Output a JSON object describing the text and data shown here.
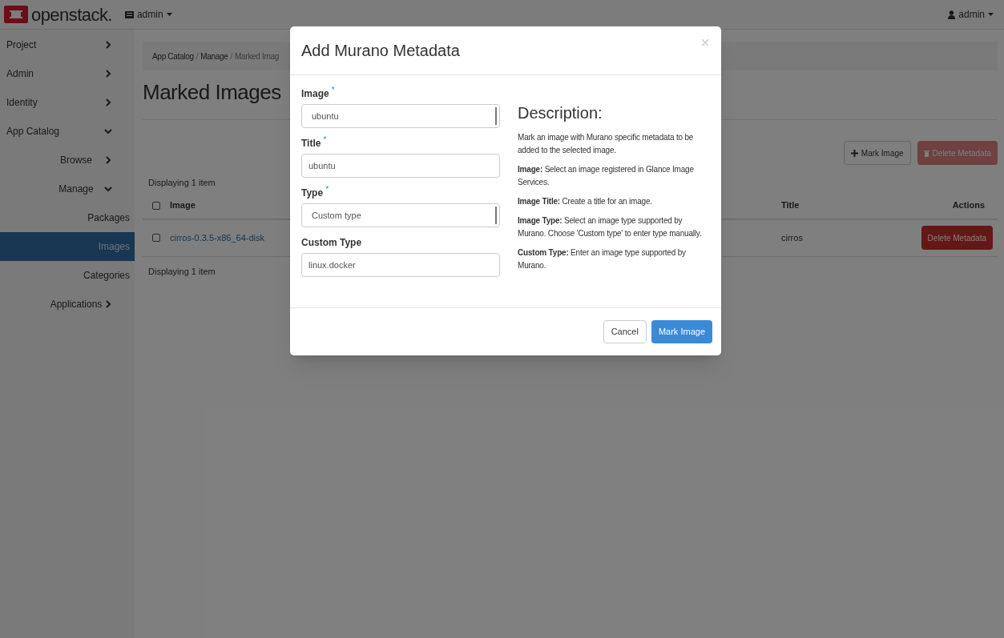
{
  "topbar": {
    "logo_text": "openstack.",
    "project_menu": "admin",
    "user_menu": "admin"
  },
  "sidebar": {
    "items": [
      {
        "label": "Project",
        "expanded": false,
        "selected": false
      },
      {
        "label": "Admin",
        "expanded": false,
        "selected": false
      },
      {
        "label": "Identity",
        "expanded": false,
        "selected": false
      },
      {
        "label": "App Catalog",
        "expanded": true,
        "selected": false,
        "children": [
          {
            "label": "Browse",
            "expanded": false,
            "selected": false
          },
          {
            "label": "Manage",
            "expanded": true,
            "selected": false,
            "children": [
              {
                "label": "Packages",
                "selected": false
              },
              {
                "label": "Images",
                "selected": true
              },
              {
                "label": "Categories",
                "selected": false
              }
            ]
          },
          {
            "label": "Applications",
            "expanded": false,
            "selected": false
          }
        ]
      }
    ]
  },
  "breadcrumb": {
    "separator": "/",
    "items": [
      "App Catalog",
      "Manage",
      "Marked Imag"
    ]
  },
  "page_title": "Marked Images",
  "actions": [
    {
      "label": "Mark Image",
      "kind": "add",
      "disabled": false
    },
    {
      "label": "Delete Metadata",
      "kind": "delete",
      "disabled": true
    }
  ],
  "table": {
    "select_all_checked": false,
    "summary_top": "Displaying 1 item",
    "summary_bottom": "Displaying 1 item",
    "columns": [
      "Image",
      "Title",
      "Actions"
    ],
    "rows": [
      {
        "checked": false,
        "image": "cirros-0.3.5-x86_64-disk",
        "title": "cirros",
        "action": "Delete Metadata"
      }
    ]
  },
  "modal": {
    "title": "Add Murano Metadata",
    "close": "×",
    "fields": [
      {
        "label": "Image",
        "required_mark": "*",
        "kind": "select",
        "value": "ubuntu"
      },
      {
        "label": "Title",
        "required_mark": "*",
        "kind": "text",
        "value": "ubuntu"
      },
      {
        "label": "Type",
        "required_mark": "*",
        "kind": "select",
        "value": "Custom type"
      },
      {
        "label": "Custom Type",
        "kind": "text",
        "value": "linux.docker"
      }
    ],
    "description_heading": "Description:",
    "description": [
      "Mark an image with Murano specific metadata to be added to the selected image.",
      "**Image:** Select an image registered in Glance Image Services.",
      "**Image Title:** Create a title for an image.",
      "**Image Type:** Select an image type supported by Murano. Choose 'Custom type' to enter type manually.",
      "**Custom Type:** Enter an image type supported by Murano."
    ],
    "buttons": [
      {
        "label": "Cancel",
        "kind": "default"
      },
      {
        "label": "Mark Image",
        "kind": "primary"
      }
    ]
  }
}
